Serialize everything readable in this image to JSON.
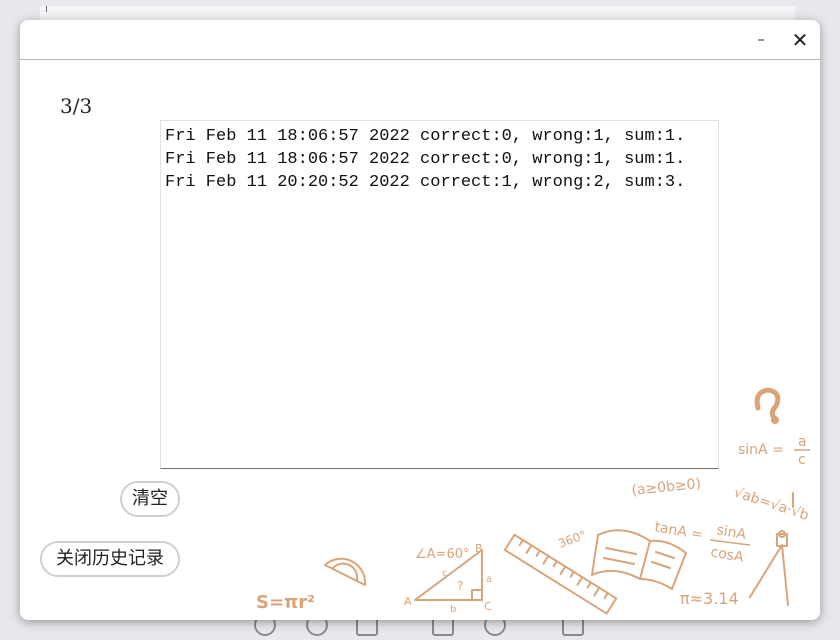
{
  "window": {
    "minimize_symbol": "–",
    "close_symbol": "✕"
  },
  "history": {
    "page_indicator": "3/3",
    "lines": [
      "Fri Feb 11 18:06:57 2022 correct:0, wrong:1, sum:1.",
      "Fri Feb 11 18:06:57 2022 correct:0, wrong:1, sum:1.",
      "Fri Feb 11 20:20:52 2022 correct:1, wrong:2, sum:3."
    ]
  },
  "buttons": {
    "clear_label": "清空",
    "close_history_label": "关闭历史记录"
  },
  "decor": {
    "accent_color": "#d9a47a",
    "formulas": {
      "sin": "sinA =",
      "sin_frac_top": "a",
      "sin_frac_bottom": "c",
      "inequality": "(a≥0b≥0)",
      "sqrt": "√ab=√a·√b",
      "tan": "tanA =",
      "tan_frac_top": "sinA",
      "tan_frac_bottom": "cosA",
      "angle": "∠A=60°",
      "circle_area": "S=πr²",
      "pi": "π≈3.14",
      "degrees": "360°",
      "question_mark": "?",
      "tri_a": "A",
      "tri_b": "B",
      "tri_c": "C",
      "side_a": "a",
      "side_b": "b",
      "side_c": "c",
      "tri_q": "?"
    }
  }
}
